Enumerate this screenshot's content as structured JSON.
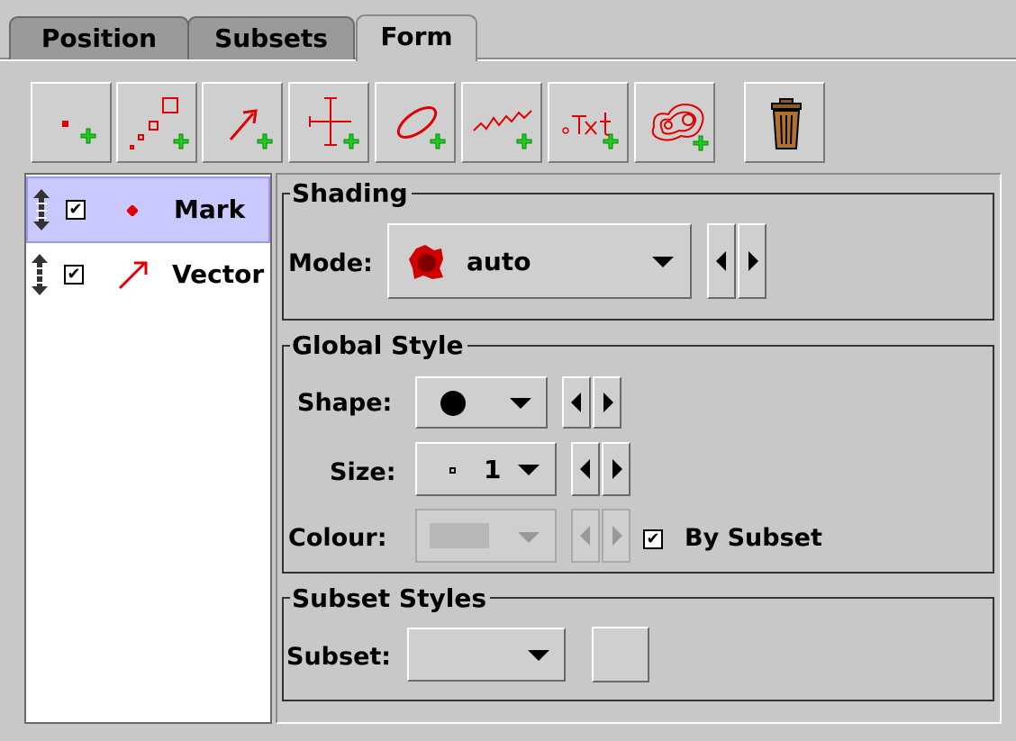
{
  "tabs": [
    {
      "label": "Position",
      "active": false
    },
    {
      "label": "Subsets",
      "active": false
    },
    {
      "label": "Form",
      "active": true
    }
  ],
  "toolbar": {
    "buttons": [
      {
        "icon": "add-mark-icon"
      },
      {
        "icon": "add-size-icon"
      },
      {
        "icon": "add-vector-icon"
      },
      {
        "icon": "add-error-icon"
      },
      {
        "icon": "add-ellipse-icon"
      },
      {
        "icon": "add-line-icon"
      },
      {
        "icon": "add-text-icon"
      },
      {
        "icon": "add-contour-icon"
      }
    ],
    "delete_icon": "trash-icon"
  },
  "layers": [
    {
      "label": "Mark",
      "checked": true,
      "selected": true,
      "icon": "mark-dot-icon"
    },
    {
      "label": "Vector",
      "checked": true,
      "selected": false,
      "icon": "vector-arrow-icon"
    }
  ],
  "shading": {
    "title": "Shading",
    "mode_label": "Mode:",
    "mode_value": "auto"
  },
  "global_style": {
    "title": "Global Style",
    "shape_label": "Shape:",
    "size_label": "Size:",
    "size_value": "1",
    "colour_label": "Colour:",
    "by_subset_label": "By Subset",
    "by_subset_checked": true
  },
  "subset_styles": {
    "title": "Subset Styles",
    "subset_label": "Subset:",
    "subset_value": ""
  },
  "colors": {
    "background": "#c8c8c8",
    "accent_red": "#e00000",
    "add_green": "#22cc22",
    "selection": "#c9c9ff"
  }
}
